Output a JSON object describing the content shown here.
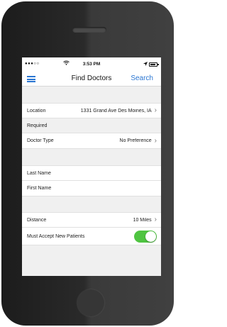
{
  "status_bar": {
    "signal": "●●●○○",
    "time": "3:53 PM"
  },
  "navbar": {
    "title": "Find Doctors",
    "search_label": "Search"
  },
  "form": {
    "location_label": "Location",
    "location_value": "1331 Grand Ave Des Moines, IA",
    "required_header": "Required",
    "doctor_type_label": "Doctor Type",
    "doctor_type_value": "No Preference",
    "last_name_label": "Last Name",
    "first_name_label": "First Name",
    "distance_label": "Distance",
    "distance_value": "10 Miles",
    "accept_new_label": "Must Accept New Patients",
    "accept_new_on": true
  },
  "icons": {
    "chevron": "›",
    "wifi": "wifi-icon",
    "menu": "hamburger-menu-icon"
  },
  "colors": {
    "accent": "#2a76d2",
    "toggle_on": "#4fc441",
    "section_bg": "#f0f0f0"
  }
}
